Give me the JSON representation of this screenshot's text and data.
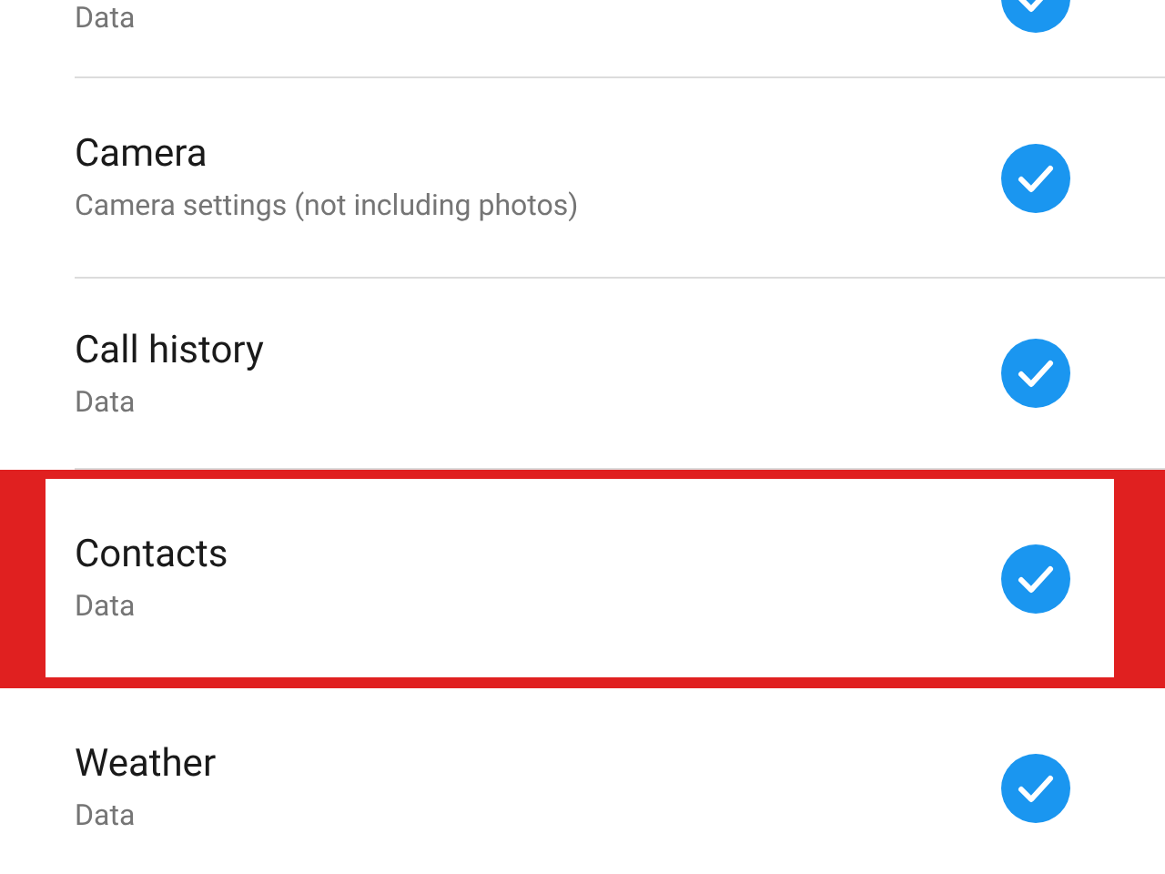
{
  "items": [
    {
      "kind": "partial",
      "subtitle": "Data",
      "checked": true,
      "highlighted": false
    },
    {
      "kind": "full",
      "title": "Camera",
      "subtitle": "Camera settings (not including photos)",
      "checked": true,
      "highlighted": false
    },
    {
      "kind": "full",
      "title": "Call history",
      "subtitle": "Data",
      "checked": true,
      "highlighted": false
    },
    {
      "kind": "full",
      "title": "Contacts",
      "subtitle": "Data",
      "checked": true,
      "highlighted": true
    },
    {
      "kind": "full",
      "title": "Weather",
      "subtitle": "Data",
      "checked": true,
      "highlighted": false
    }
  ]
}
